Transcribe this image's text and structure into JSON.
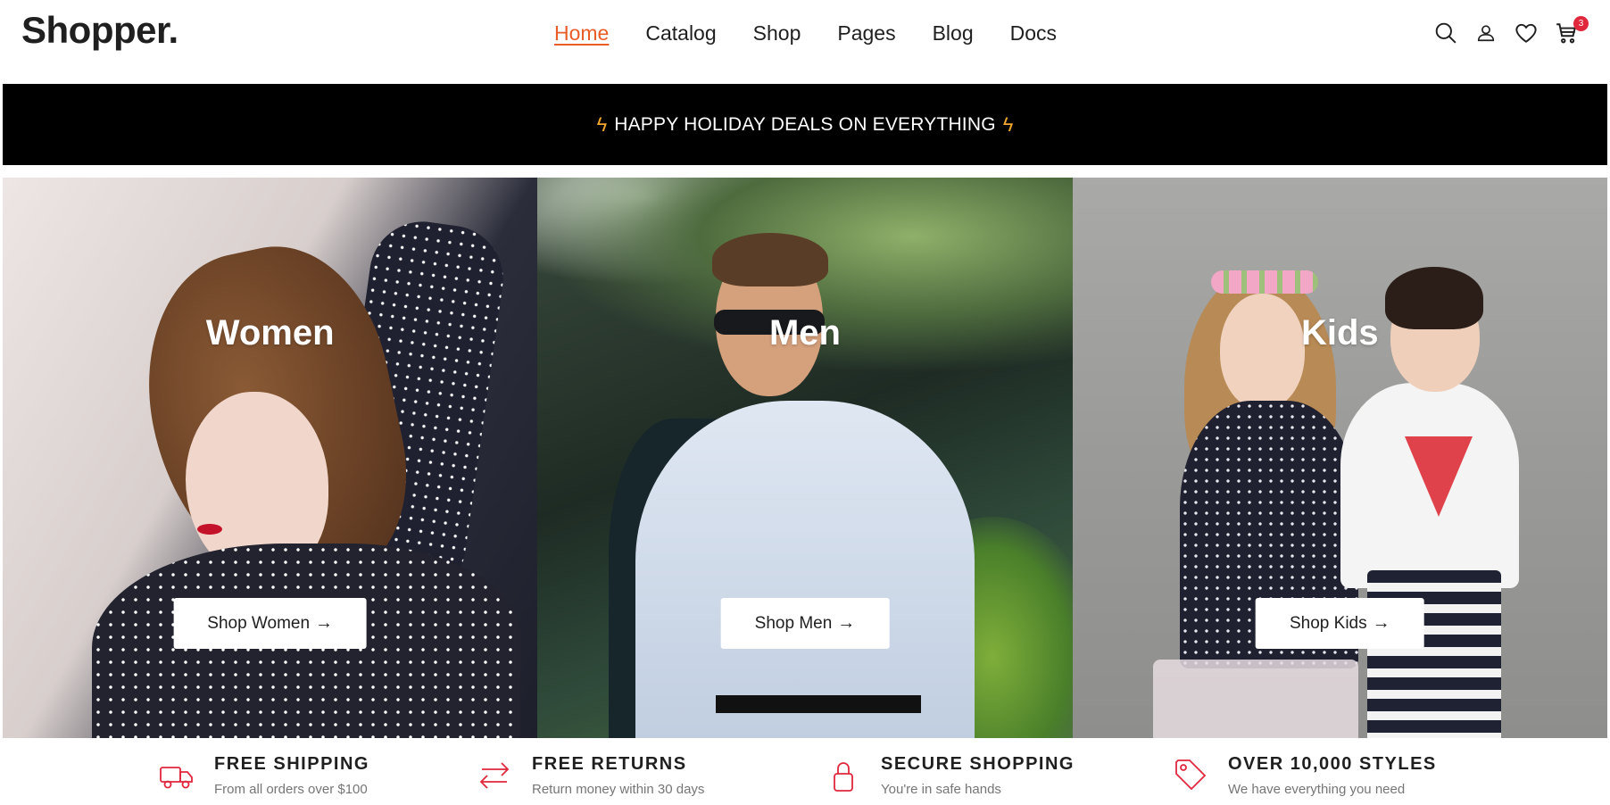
{
  "header": {
    "logo": "Shopper.",
    "nav": [
      {
        "label": "Home",
        "active": true
      },
      {
        "label": "Catalog",
        "active": false
      },
      {
        "label": "Shop",
        "active": false
      },
      {
        "label": "Pages",
        "active": false
      },
      {
        "label": "Blog",
        "active": false
      },
      {
        "label": "Docs",
        "active": false
      }
    ],
    "icons": [
      "search-icon",
      "user-icon",
      "heart-icon",
      "cart-icon"
    ],
    "cart_count": "3"
  },
  "promo": {
    "text": "HAPPY HOLIDAY DEALS ON EVERYTHING",
    "icon": "bolt-icon"
  },
  "tiles": [
    {
      "title": "Women",
      "button": "Shop Women",
      "arrow": "→"
    },
    {
      "title": "Men",
      "button": "Shop Men",
      "arrow": "→"
    },
    {
      "title": "Kids",
      "button": "Shop Kids",
      "arrow": "→"
    }
  ],
  "features": [
    {
      "icon": "truck-icon",
      "title": "FREE SHIPPING",
      "subtitle": "From all orders over $100"
    },
    {
      "icon": "exchange-icon",
      "title": "FREE RETURNS",
      "subtitle": "Return money within 30 days"
    },
    {
      "icon": "lock-icon",
      "title": "SECURE SHOPPING",
      "subtitle": "You're in safe hands"
    },
    {
      "icon": "tag-icon",
      "title": "OVER 10,000 STYLES",
      "subtitle": "We have everything you need"
    }
  ],
  "colors": {
    "accent": "#e95c27",
    "badge": "#e0273c",
    "bolt": "#f0a72c",
    "promo_bg": "#000000"
  }
}
